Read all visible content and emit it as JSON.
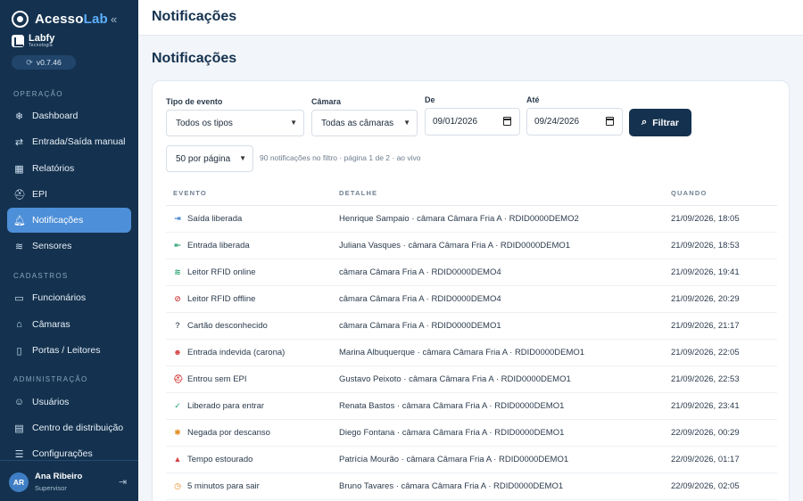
{
  "app": {
    "brand_prefix": "Acesso",
    "brand_suffix": "Lab",
    "company_name": "Labfy",
    "company_sub": "Tecnologia",
    "version": "v0.7.46"
  },
  "sidebar": {
    "sections": [
      {
        "label": "OPERAÇÃO"
      },
      {
        "label": "CADASTROS"
      },
      {
        "label": "ADMINISTRAÇÃO"
      }
    ],
    "items": [
      {
        "label": "Dashboard",
        "icon": "snowflake-icon"
      },
      {
        "label": "Entrada/Saída manual",
        "icon": "swap-arrows-icon"
      },
      {
        "label": "Relatórios",
        "icon": "bar-chart-icon"
      },
      {
        "label": "EPI",
        "icon": "hard-hat-icon"
      },
      {
        "label": "Notificações",
        "icon": "bell-icon",
        "active": true
      },
      {
        "label": "Sensores",
        "icon": "wifi-icon"
      },
      {
        "label": "Funcionários",
        "icon": "id-card-icon"
      },
      {
        "label": "Câmaras",
        "icon": "warehouse-icon"
      },
      {
        "label": "Portas / Leitores",
        "icon": "door-icon"
      },
      {
        "label": "Usuários",
        "icon": "users-icon"
      },
      {
        "label": "Centro de distribuição",
        "icon": "building-icon"
      },
      {
        "label": "Configurações",
        "icon": "sliders-icon"
      }
    ],
    "user": {
      "initials": "AR",
      "name": "Ana Ribeiro",
      "role": "Supervisor"
    }
  },
  "topbar": {
    "title": "Notificações"
  },
  "page": {
    "title": "Notificações"
  },
  "filters": {
    "event_type_label": "Tipo de evento",
    "event_type_value": "Todos os tipos",
    "chamber_label": "Câmara",
    "chamber_value": "Todas as câmaras",
    "from_label": "De",
    "from_value": "09/01/2026",
    "to_label": "Até",
    "to_value": "09/24/2026",
    "filter_button": "Filtrar",
    "per_page_value": "50 por página",
    "meta": "90 notificações no filtro · página 1 de 2  · ao vivo"
  },
  "table": {
    "columns": [
      "EVENTO",
      "DETALHE",
      "QUANDO"
    ],
    "rows": [
      {
        "icon": "exit-arrow-icon",
        "icon_color": "#3a7bd5",
        "event": "Saída liberada",
        "detail": "Henrique Sampaio · câmara Câmara Fria A · RDID0000DEMO2",
        "when": "21/09/2026, 18:05"
      },
      {
        "icon": "enter-arrow-icon",
        "icon_color": "#22a06b",
        "event": "Entrada liberada",
        "detail": "Juliana Vasques · câmara Câmara Fria A · RDID0000DEMO1",
        "when": "21/09/2026, 18:53"
      },
      {
        "icon": "wifi-icon",
        "icon_color": "#22a06b",
        "event": "Leitor RFID online",
        "detail": "câmara Câmara Fria A · RDID0000DEMO4",
        "when": "21/09/2026, 19:41"
      },
      {
        "icon": "wifi-off-icon",
        "icon_color": "#d64545",
        "event": "Leitor RFID offline",
        "detail": "câmara Câmara Fria A · RDID0000DEMO4",
        "when": "21/09/2026, 20:29"
      },
      {
        "icon": "question-circle-icon",
        "icon_color": "#5b6775",
        "event": "Cartão desconhecido",
        "detail": "câmara Câmara Fria A · RDID0000DEMO1",
        "when": "21/09/2026, 21:17"
      },
      {
        "icon": "users-icon",
        "icon_color": "#d64545",
        "event": "Entrada indevida (carona)",
        "detail": "Marina Albuquerque · câmara Câmara Fria A · RDID0000DEMO1",
        "when": "21/09/2026, 22:05"
      },
      {
        "icon": "hard-hat-icon",
        "icon_color": "#d64545",
        "event": "Entrou sem EPI",
        "detail": "Gustavo Peixoto · câmara Câmara Fria A · RDID0000DEMO1",
        "when": "21/09/2026, 22:53"
      },
      {
        "icon": "check-circle-icon",
        "icon_color": "#22a06b",
        "event": "Liberado para entrar",
        "detail": "Renata Bastos · câmara Câmara Fria A · RDID0000DEMO1",
        "when": "21/09/2026, 23:41"
      },
      {
        "icon": "snowflake-icon",
        "icon_color": "#e08a1e",
        "event": "Negada por descanso",
        "detail": "Diego Fontana · câmara Câmara Fria A · RDID0000DEMO1",
        "when": "22/09/2026, 00:29"
      },
      {
        "icon": "warning-icon",
        "icon_color": "#d64545",
        "event": "Tempo estourado",
        "detail": "Patrícia Mourão · câmara Câmara Fria A · RDID0000DEMO1",
        "when": "22/09/2026, 01:17"
      },
      {
        "icon": "clock-icon",
        "icon_color": "#e08a1e",
        "event": "5 minutos para sair",
        "detail": "Bruno Tavares · câmara Câmara Fria A · RDID0000DEMO1",
        "when": "22/09/2026, 02:05"
      }
    ]
  }
}
